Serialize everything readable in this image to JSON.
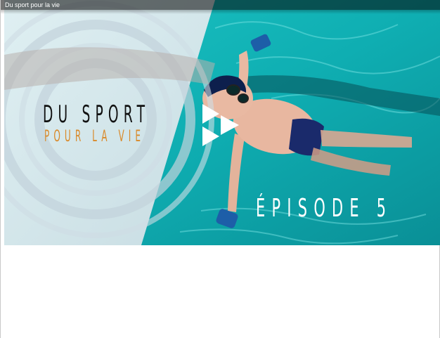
{
  "window": {
    "title": "Du sport pour la vie"
  },
  "video": {
    "show_title_line1": "DU SPORT",
    "show_title_line2": "POUR LA VIE",
    "episode_label": "ÉPISODE 5",
    "play_icon": "play-logo-icon",
    "colors": {
      "pool_teal": "#0fb3b6",
      "panel_light": "#dfe7ec",
      "title_dark": "#111111",
      "title_orange": "#d98a2b",
      "episode_white": "#ffffff"
    }
  }
}
